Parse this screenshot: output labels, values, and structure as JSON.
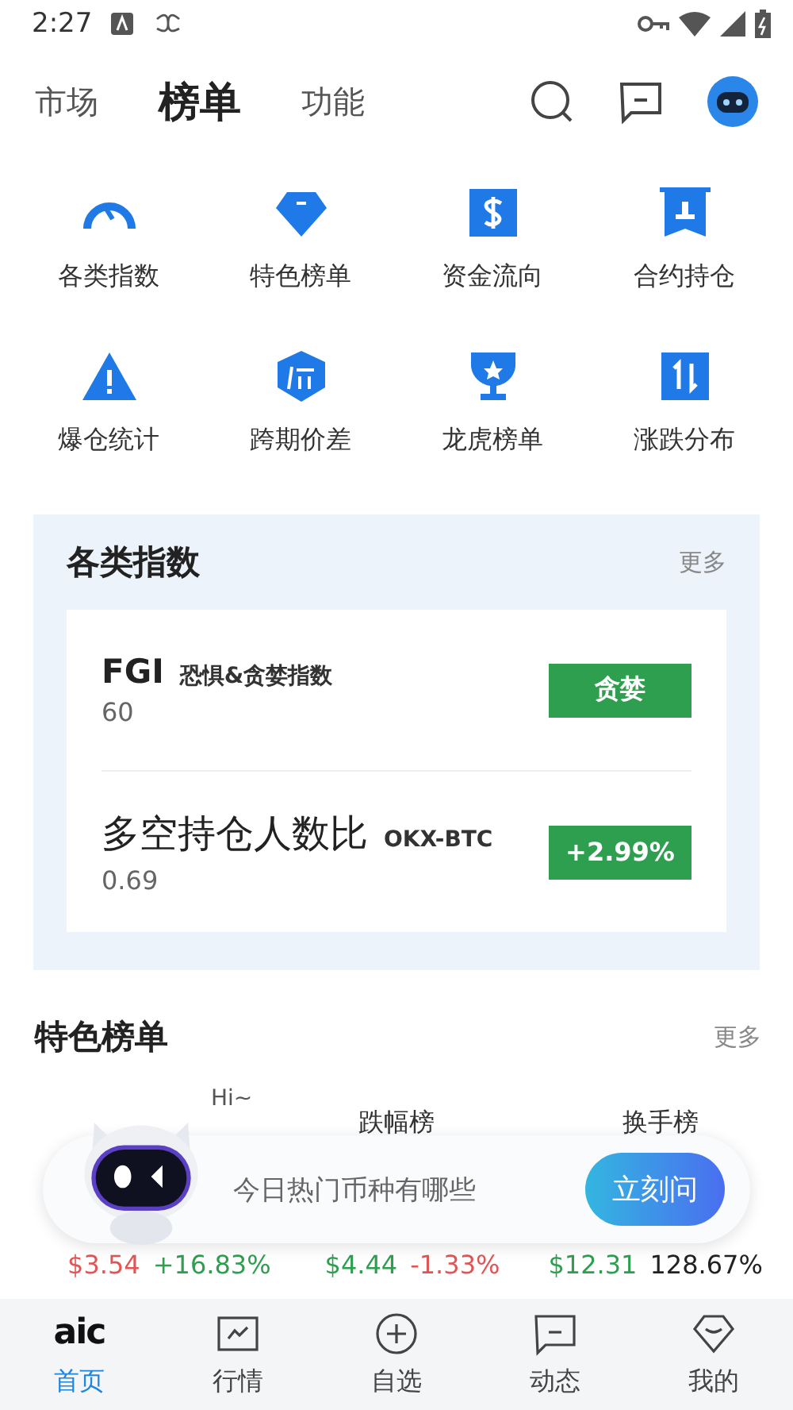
{
  "status_bar": {
    "time": "2:27"
  },
  "tabs": [
    {
      "label": "市场",
      "selected": false
    },
    {
      "label": "榜单",
      "selected": true
    },
    {
      "label": "功能",
      "selected": false
    }
  ],
  "shortcuts": [
    {
      "label": "各类指数"
    },
    {
      "label": "特色榜单"
    },
    {
      "label": "资金流向"
    },
    {
      "label": "合约持仓"
    },
    {
      "label": "爆仓统计"
    },
    {
      "label": "跨期价差"
    },
    {
      "label": "龙虎榜单"
    },
    {
      "label": "涨跌分布"
    }
  ],
  "index_panel": {
    "title": "各类指数",
    "more": "更多",
    "rows": [
      {
        "name": "FGI",
        "subtitle": "恐惧&贪婪指数",
        "value": "60",
        "badge": "贪婪"
      },
      {
        "name": "多空持仓人数比",
        "subtitle": "OKX-BTC",
        "value": "0.69",
        "badge": "+2.99%"
      }
    ]
  },
  "featured": {
    "title": "特色榜单",
    "more": "更多",
    "columns": [
      {
        "header": "跌幅榜"
      },
      {
        "header": "换手榜"
      }
    ],
    "prices": [
      {
        "price": {
          "text": "$3.54",
          "color": "#e05555"
        },
        "change": {
          "text": "+16.83%",
          "color": "#2e9e4f"
        }
      },
      {
        "price": {
          "text": "$4.44",
          "color": "#2e9e4f"
        },
        "change": {
          "text": "-1.33%",
          "color": "#e05555"
        }
      },
      {
        "price": {
          "text": "$12.31",
          "color": "#2e9e4f"
        },
        "change": {
          "text": "128.67%",
          "color": "#222222"
        }
      }
    ]
  },
  "assistant": {
    "greeting": "Hi~",
    "prompt": "今日热门币种有哪些",
    "button": "立刻问"
  },
  "bottom_nav": [
    {
      "label": "首页",
      "logo": "aic",
      "selected": true
    },
    {
      "label": "行情",
      "selected": false
    },
    {
      "label": "自选",
      "selected": false
    },
    {
      "label": "动态",
      "selected": false
    },
    {
      "label": "我的",
      "selected": false
    }
  ]
}
